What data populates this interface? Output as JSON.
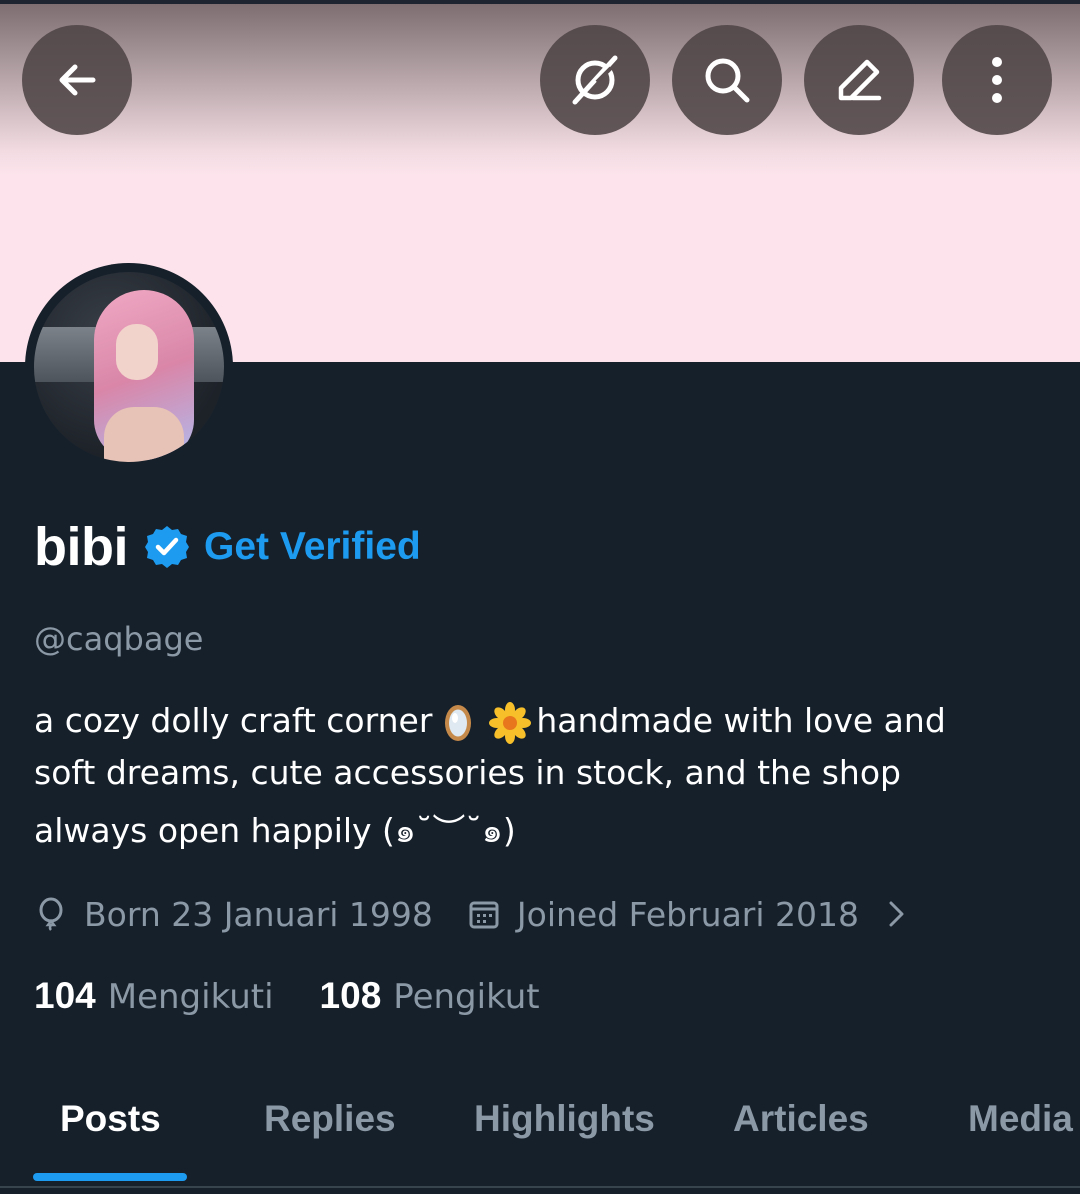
{
  "header": {
    "back_icon": "arrow-left-icon",
    "grok_icon": "grok-icon",
    "search_icon": "search-icon",
    "edit_icon": "edit-icon",
    "more_icon": "more-vertical-icon",
    "banner_color": "#fde4ec"
  },
  "profile": {
    "display_name": "bibi",
    "verified_badge_icon": "verified-badge-icon",
    "get_verified": "Get Verified",
    "handle": "@caqbage",
    "bio": {
      "line1_before": "a cozy dolly craft corner",
      "emoji1": "mirror-emoji",
      "emoji2": "blossom-emoji",
      "line1_after": "handmade with love and",
      "line2": "soft dreams, cute accessories in stock, and the shop",
      "line3": "always open happily (๑˘︶˘๑)"
    },
    "born": "Born 23 Januari 1998",
    "joined": "Joined Februari 2018",
    "following_count": "104",
    "following_label": "Mengikuti",
    "followers_count": "108",
    "followers_label": "Pengikut"
  },
  "tabs": [
    {
      "label": "Posts",
      "active": true
    },
    {
      "label": "Replies",
      "active": false
    },
    {
      "label": "Highlights",
      "active": false
    },
    {
      "label": "Articles",
      "active": false
    },
    {
      "label": "Media",
      "active": false
    }
  ],
  "colors": {
    "accent": "#1d9bf0",
    "background": "#15202b",
    "secondary_text": "#8b98a5"
  }
}
